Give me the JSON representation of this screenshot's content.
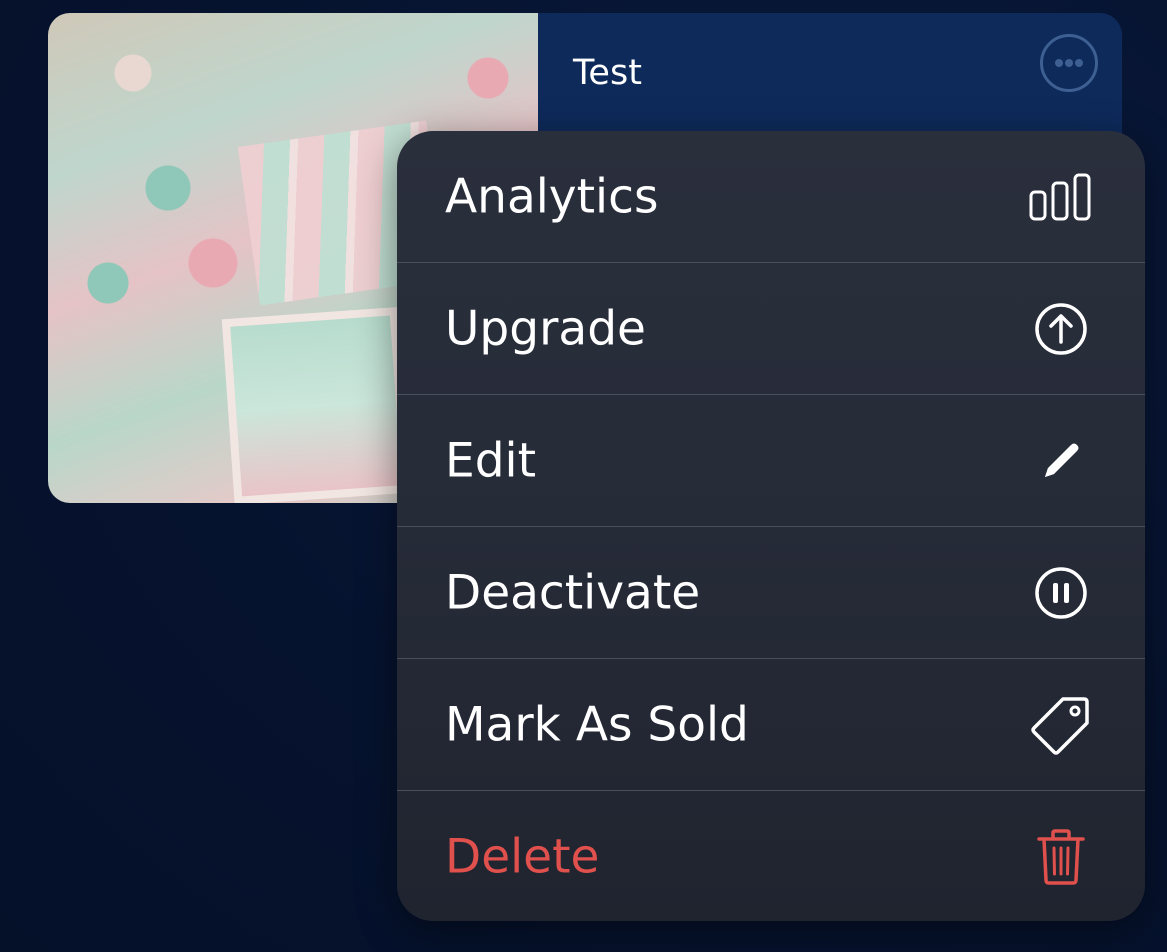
{
  "listing": {
    "title": "Test",
    "more_icon": "ellipsis-circle-icon"
  },
  "menu": {
    "items": [
      {
        "label": "Analytics",
        "icon": "bar-chart-icon"
      },
      {
        "label": "Upgrade",
        "icon": "arrow-up-circle-icon"
      },
      {
        "label": "Edit",
        "icon": "pencil-icon"
      },
      {
        "label": "Deactivate",
        "icon": "pause-circle-icon"
      },
      {
        "label": "Mark As Sold",
        "icon": "tag-icon"
      },
      {
        "label": "Delete",
        "icon": "trash-icon"
      }
    ]
  },
  "colors": {
    "background": "#06132f",
    "card_accent": "#0e2a5b",
    "menu_background": "#262b38",
    "destructive": "#e0504c",
    "text": "#ffffff"
  }
}
